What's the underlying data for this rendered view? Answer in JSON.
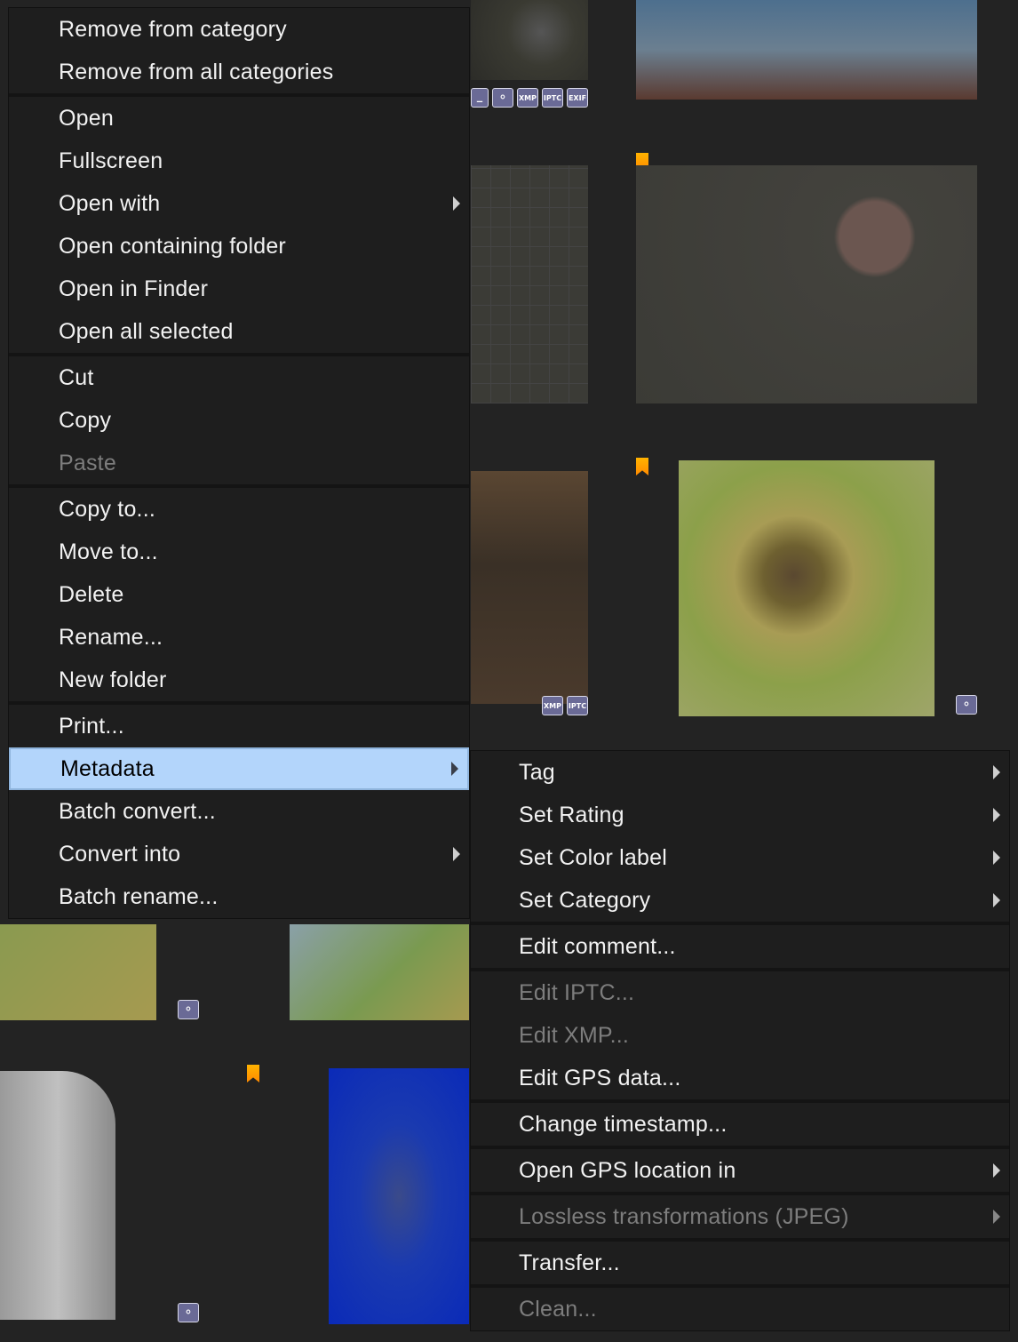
{
  "main_menu": [
    {
      "label": "Remove from category"
    },
    {
      "label": "Remove from all categories"
    },
    {
      "sep": true
    },
    {
      "label": "Open"
    },
    {
      "label": "Fullscreen"
    },
    {
      "label": "Open with",
      "submenu": true
    },
    {
      "label": "Open containing folder"
    },
    {
      "label": "Open in Finder"
    },
    {
      "label": "Open all selected"
    },
    {
      "sep": true
    },
    {
      "label": "Cut"
    },
    {
      "label": "Copy"
    },
    {
      "label": "Paste",
      "disabled": true
    },
    {
      "sep": true
    },
    {
      "label": "Copy to..."
    },
    {
      "label": "Move to..."
    },
    {
      "label": "Delete"
    },
    {
      "label": "Rename..."
    },
    {
      "label": "New folder"
    },
    {
      "sep": true
    },
    {
      "label": "Print..."
    },
    {
      "label": "Metadata",
      "submenu": true,
      "active": true
    },
    {
      "label": "Batch convert..."
    },
    {
      "label": "Convert into",
      "submenu": true
    },
    {
      "label": "Batch rename..."
    }
  ],
  "metadata_submenu": [
    {
      "label": "Tag",
      "submenu": true
    },
    {
      "label": "Set Rating",
      "submenu": true
    },
    {
      "label": "Set Color label",
      "submenu": true
    },
    {
      "label": "Set Category",
      "submenu": true
    },
    {
      "sep": true
    },
    {
      "label": "Edit comment..."
    },
    {
      "sep": true
    },
    {
      "label": "Edit IPTC...",
      "disabled": true
    },
    {
      "label": "Edit XMP...",
      "disabled": true
    },
    {
      "label": "Edit GPS data..."
    },
    {
      "sep": true
    },
    {
      "label": "Change timestamp..."
    },
    {
      "sep": true
    },
    {
      "label": "Open GPS location in",
      "submenu": true
    },
    {
      "sep": true
    },
    {
      "label": "Lossless transformations (JPEG)",
      "submenu": true,
      "disabled": true
    },
    {
      "sep": true
    },
    {
      "label": "Transfer..."
    },
    {
      "sep": true
    },
    {
      "label": "Clean...",
      "disabled": true
    }
  ],
  "badges": {
    "xmp": "XMP",
    "iptc": "IPTC",
    "exif": "EXIF"
  },
  "colors": {
    "highlight": "#b3d5fb",
    "badge": "#6a6a96",
    "bookmark": "#ff9f00"
  }
}
